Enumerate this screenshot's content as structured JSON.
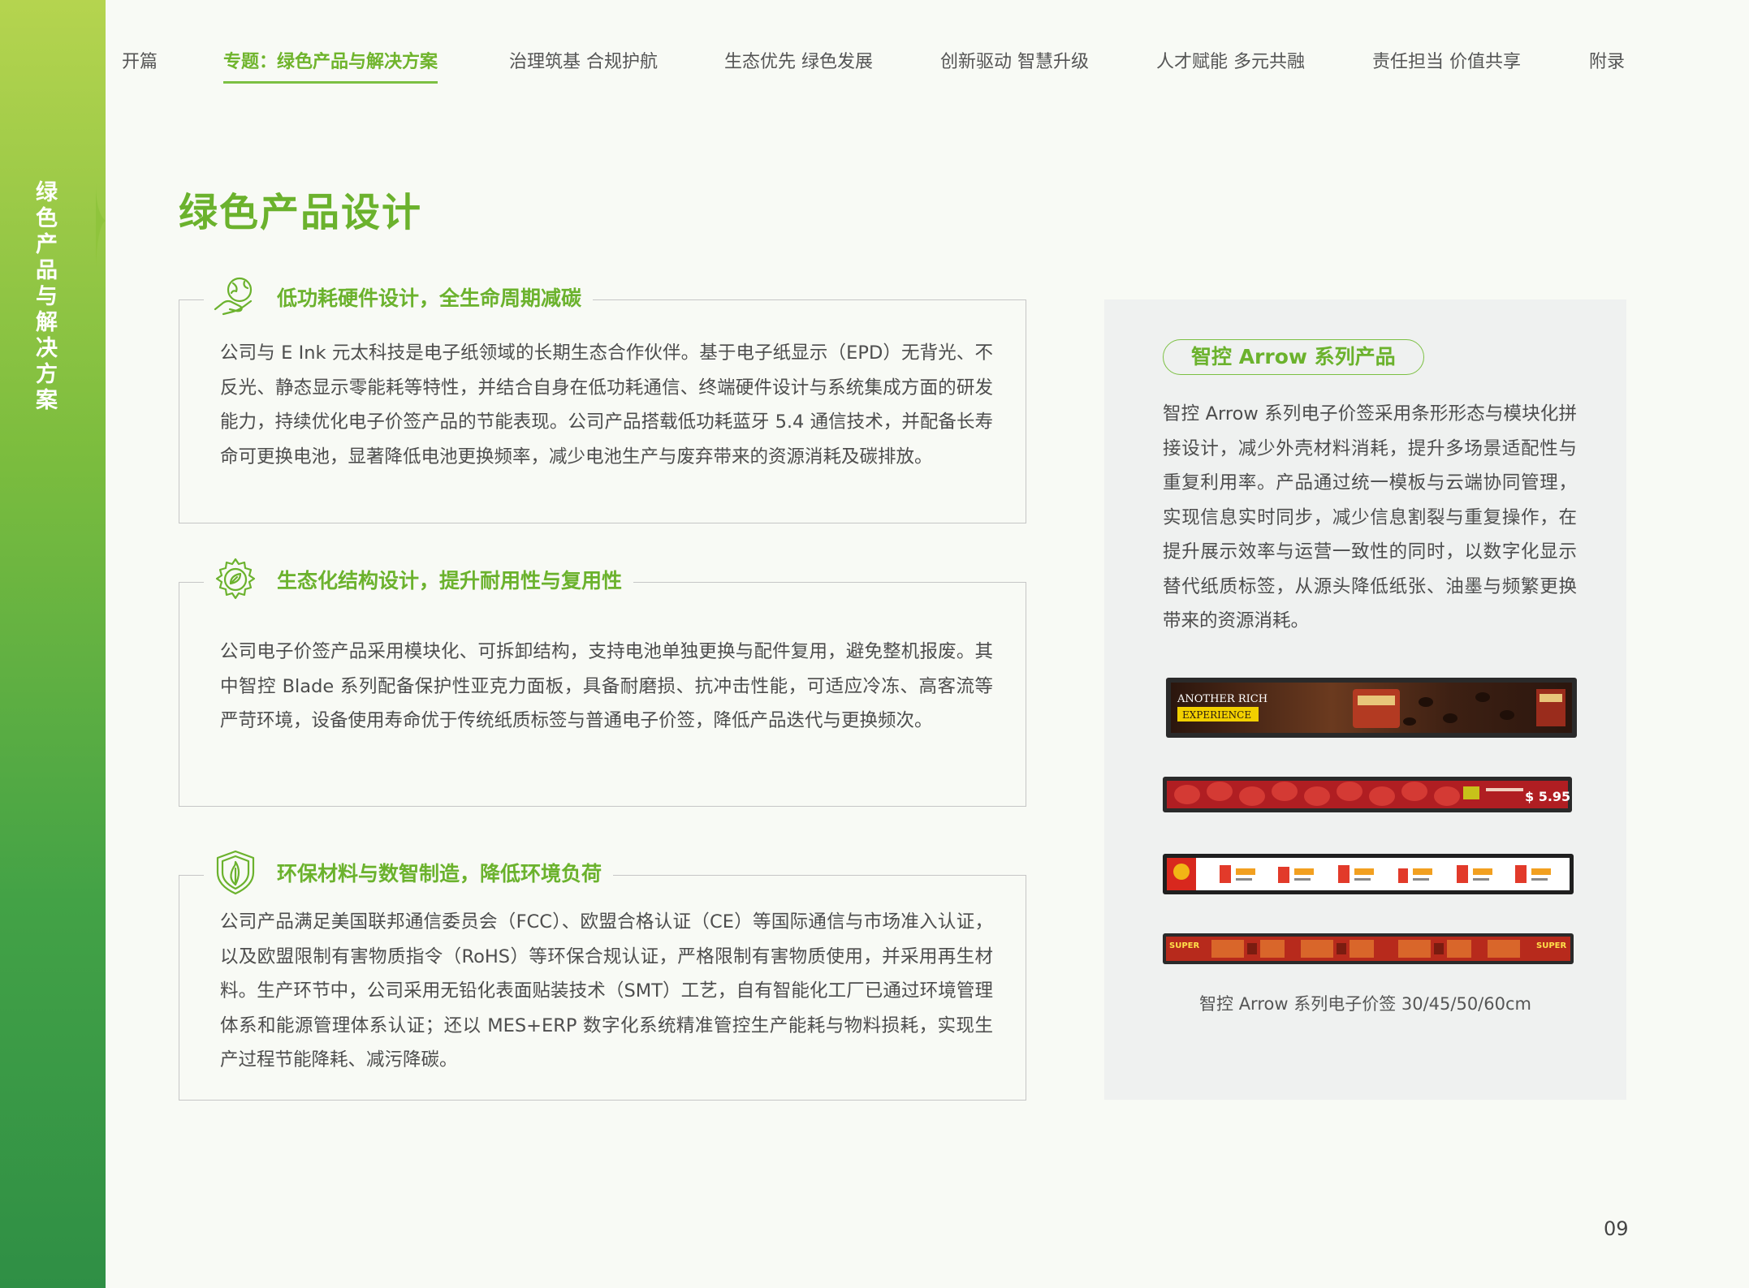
{
  "sidebar": {
    "label": "绿色产品与解决方案"
  },
  "nav": {
    "items": [
      {
        "label": "开篇"
      },
      {
        "label": "专题：绿色产品与解决方案"
      },
      {
        "label": "治理筑基 合规护航"
      },
      {
        "label": "生态优先 绿色发展"
      },
      {
        "label": "创新驱动 智慧升级"
      },
      {
        "label": "人才赋能 多元共融"
      },
      {
        "label": "责任担当 价值共享"
      },
      {
        "label": "附录"
      }
    ],
    "active_index": 1
  },
  "page": {
    "title": "绿色产品设计",
    "number": "09"
  },
  "sections": [
    {
      "icon": "leaf-hand-icon",
      "heading": "低功耗硬件设计，全生命周期减碳",
      "body": "公司与 E Ink 元太科技是电子纸领域的长期生态合作伙伴。基于电子纸显示（EPD）无背光、不反光、静态显示零能耗等特性，并结合自身在低功耗通信、终端硬件设计与系统集成方面的研发能力，持续优化电子价签产品的节能表现。公司产品搭载低功耗蓝牙 5.4 通信技术，并配备长寿命可更换电池，显著降低电池更换频率，减少电池生产与废弃带来的资源消耗及碳排放。"
    },
    {
      "icon": "eco-gear-icon",
      "heading": "生态化结构设计，提升耐用性与复用性",
      "body": "公司电子价签产品采用模块化、可拆卸结构，支持电池单独更换与配件复用，避免整机报废。其中智控 Blade 系列配备保护性亚克力面板，具备耐磨损、抗冲击性能，可适应冷冻、高客流等严苛环境，设备使用寿命优于传统纸质标签与普通电子价签，降低产品迭代与更换频次。"
    },
    {
      "icon": "shield-leaf-icon",
      "heading": "环保材料与数智制造，降低环境负荷",
      "body": "公司产品满足美国联邦通信委员会（FCC）、欧盟合格认证（CE）等国际通信与市场准入认证，以及欧盟限制有害物质指令（RoHS）等环保合规认证，严格限制有害物质使用，并采用再生材料。生产环节中，公司采用无铅化表面贴装技术（SMT）工艺，自有智能化工厂已通过环境管理体系和能源管理体系认证；还以 MES+ERP 数字化系统精准管控生产能耗与物料损耗，实现生产过程节能降耗、减污降碳。"
    }
  ],
  "panel": {
    "pill": "智控 Arrow 系列产品",
    "body": "智控 Arrow 系列电子价签采用条形形态与模块化拼接设计，减少外壳材料消耗，提升多场景适配性与重复利用率。产品通过统一模板与云端协同管理，实现信息实时同步，减少信息割裂与重复操作，在提升展示效率与运营一致性的同时，以数字化显示替代纸质标签，从源头降低纸张、油墨与频繁更换带来的资源消耗。",
    "caption": "智控 Arrow 系列电子价签 30/45/50/60cm",
    "strip1": {
      "line1": "ANOTHER RICH",
      "line2": "EXPERIENCE"
    },
    "strip2": {
      "price": "$ 5.95"
    },
    "strip4": {
      "left": "SUPER",
      "right": "SUPER"
    }
  },
  "colors": {
    "accent": "#6bb22d",
    "sidebar_top": "#b5d44f",
    "sidebar_bottom": "#2f8f45"
  }
}
